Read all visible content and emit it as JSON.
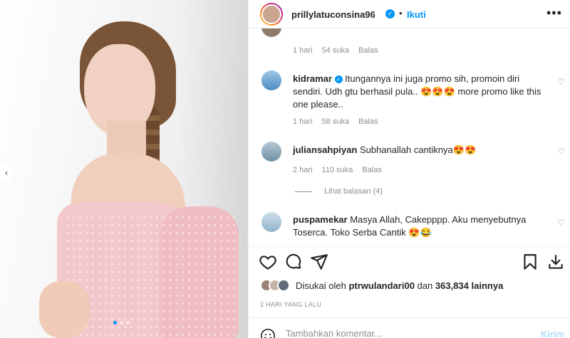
{
  "header": {
    "username": "prillylatuconsina96",
    "verified_mark": "✓",
    "separator": "•",
    "follow_label": "Ikuti",
    "more_label": "•••"
  },
  "comments": [
    {
      "username": "",
      "text": "",
      "time": "1 hari",
      "likes": "54 suka",
      "reply": "Balas"
    },
    {
      "username": "kidramar",
      "verified": true,
      "text": "Itungannya ini juga promo sih, promoin diri sendiri. Udh gtu berhasil pula.. 😍😍😍 more promo like this one please..",
      "time": "1 hari",
      "likes": "58 suka",
      "reply": "Balas"
    },
    {
      "username": "juliansahpiyan",
      "text": "Subhanallah cantiknya😍😍",
      "time": "2 hari",
      "likes": "110 suka",
      "reply": "Balas"
    },
    {
      "username": "puspamekar",
      "text": "Masya Allah, Cakepppp. Aku menyebutnya Toserca. Toko Serba Cantik 😍😂"
    }
  ],
  "view_replies": "Lihat balasan (4)",
  "likes": {
    "prefix": "Disukai oleh",
    "user": "ptrwulandari00",
    "middle": "dan",
    "count": "363,834",
    "suffix": "lainnya"
  },
  "time_ago": "2 HARI YANG LALU",
  "add_comment": {
    "placeholder": "Tambahkan komentar...",
    "post_label": "Kirim"
  },
  "carousel": {
    "prev": "‹",
    "dots": 3,
    "active_dot": 1
  },
  "icons": [
    "more-options-icon",
    "heart-icon",
    "comment-icon",
    "share-icon",
    "bookmark-icon",
    "download-icon",
    "emoji-icon",
    "verified-icon"
  ],
  "colors": {
    "accent": "#0095f6",
    "text": "#262626",
    "muted": "#8e8e8e",
    "post_disabled": "#b2dffc"
  }
}
